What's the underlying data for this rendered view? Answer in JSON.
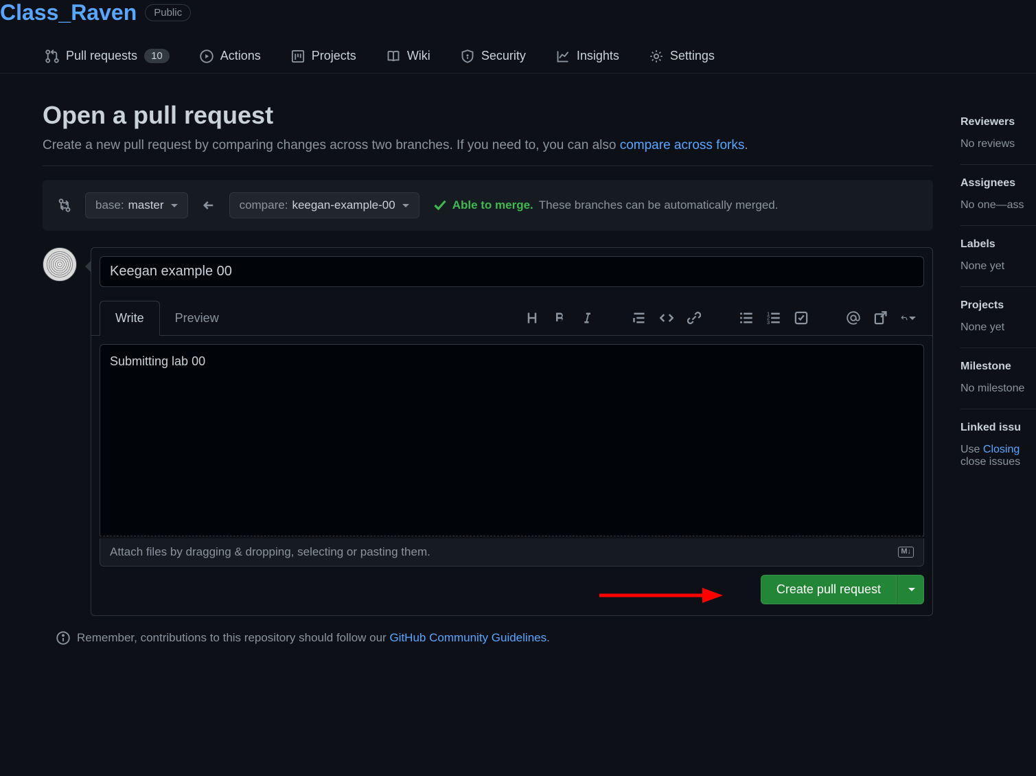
{
  "repo": {
    "name": "Class_Raven",
    "visibility": "Public"
  },
  "nav": {
    "pull_requests": {
      "label": "Pull requests",
      "count": "10"
    },
    "actions": "Actions",
    "projects": "Projects",
    "wiki": "Wiki",
    "security": "Security",
    "insights": "Insights",
    "settings": "Settings"
  },
  "page": {
    "title": "Open a pull request",
    "subtitle_a": "Create a new pull request by comparing changes across two branches. If you need to, you can also ",
    "subtitle_link": "compare across forks",
    "subtitle_b": "."
  },
  "branches": {
    "base_label": "base:",
    "base_name": "master",
    "compare_label": "compare:",
    "compare_name": "keegan-example-00",
    "merge_ok": "Able to merge.",
    "merge_desc": "These branches can be automatically merged."
  },
  "editor": {
    "title_value": "Keegan example 00",
    "write_tab": "Write",
    "preview_tab": "Preview",
    "body_value": "Submitting lab 00",
    "attach_text": "Attach files by dragging & dropping, selecting or pasting them.",
    "md_badge": "M↓",
    "create_label": "Create pull request"
  },
  "footer": {
    "prefix": "Remember, contributions to this repository should follow our ",
    "link": "GitHub Community Guidelines",
    "suffix": "."
  },
  "sidebar": {
    "reviewers": {
      "title": "Reviewers",
      "value": "No reviews"
    },
    "assignees": {
      "title": "Assignees",
      "value": "No one—ass"
    },
    "labels": {
      "title": "Labels",
      "value": "None yet"
    },
    "projects": {
      "title": "Projects",
      "value": "None yet"
    },
    "milestone": {
      "title": "Milestone",
      "value": "No milestone"
    },
    "linked": {
      "title": "Linked issu",
      "prefix": "Use ",
      "link": "Closing",
      "suffix": " close issues "
    }
  }
}
